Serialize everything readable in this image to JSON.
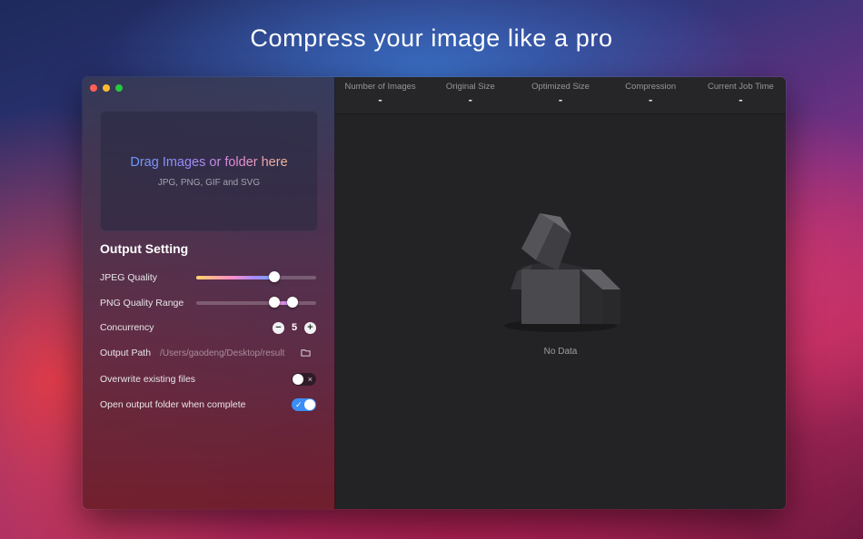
{
  "headline": "Compress your image like a pro",
  "sidebar": {
    "dropzone": {
      "title": "Drag Images or folder here",
      "subtitle": "JPG, PNG, GIF and SVG"
    },
    "output_setting": {
      "title": "Output Setting",
      "jpeg_quality": {
        "label": "JPEG Quality",
        "value": 0.65
      },
      "png_quality_range": {
        "label": "PNG Quality Range",
        "min": 0.65,
        "max": 0.8
      },
      "concurrency": {
        "label": "Concurrency",
        "value": "5",
        "minus": "−",
        "plus": "+"
      },
      "output_path": {
        "label": "Output Path",
        "value": "/Users/gaodeng/Desktop/result"
      },
      "overwrite": {
        "label": "Overwrite existing files",
        "enabled": false,
        "mark": "×"
      },
      "open_folder": {
        "label": "Open output folder when complete",
        "enabled": true,
        "mark": "✓"
      }
    }
  },
  "stats": [
    {
      "label": "Number of Images",
      "value": "-"
    },
    {
      "label": "Original Size",
      "value": "-"
    },
    {
      "label": "Optimized Size",
      "value": "-"
    },
    {
      "label": "Compression",
      "value": "-"
    },
    {
      "label": "Current Job Time",
      "value": "-"
    }
  ],
  "empty_state": {
    "text": "No Data",
    "icon": "empty-box-icon"
  },
  "colors": {
    "accent": "#3b8ef6",
    "close": "#fe5f57",
    "minimize": "#febc2e",
    "zoom": "#28c840"
  }
}
